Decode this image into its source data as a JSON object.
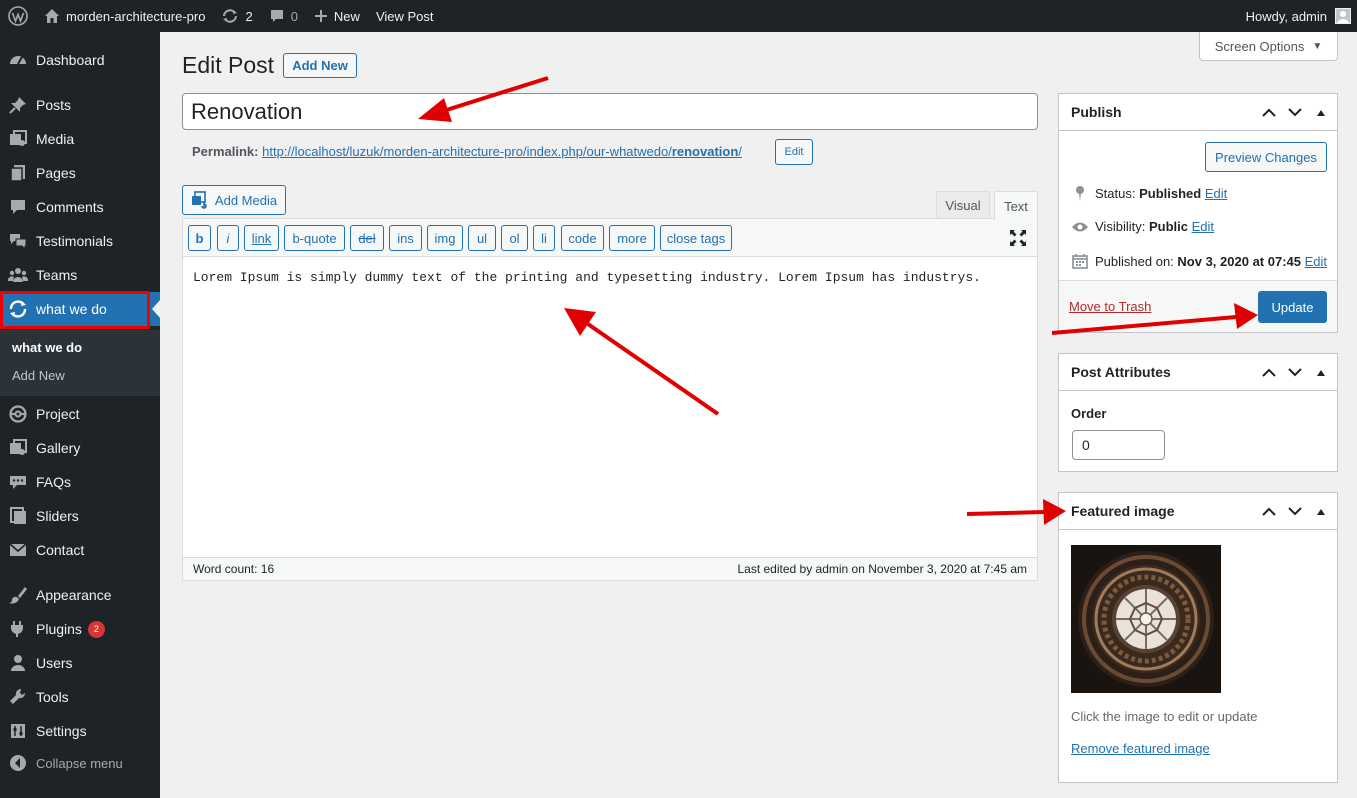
{
  "adminbar": {
    "site_name": "morden-architecture-pro",
    "updates_count": "2",
    "comments_count": "0",
    "new_label": "New",
    "view_post_label": "View Post",
    "howdy": "Howdy, admin"
  },
  "sidebar": {
    "items": [
      {
        "label": "Dashboard",
        "icon": "dashboard-icon"
      },
      {
        "label": "Posts",
        "icon": "pin-icon"
      },
      {
        "label": "Media",
        "icon": "media-icon"
      },
      {
        "label": "Pages",
        "icon": "page-icon"
      },
      {
        "label": "Comments",
        "icon": "comment-icon"
      },
      {
        "label": "Testimonials",
        "icon": "testimonial-icon"
      },
      {
        "label": "Teams",
        "icon": "groups-icon"
      },
      {
        "label": "what we do",
        "icon": "update-icon"
      },
      {
        "label": "Project",
        "icon": "project-icon"
      },
      {
        "label": "Gallery",
        "icon": "gallery-icon"
      },
      {
        "label": "FAQs",
        "icon": "faq-icon"
      },
      {
        "label": "Sliders",
        "icon": "slider-icon"
      },
      {
        "label": "Contact",
        "icon": "email-icon"
      },
      {
        "label": "Appearance",
        "icon": "brush-icon"
      },
      {
        "label": "Plugins",
        "icon": "plugin-icon"
      },
      {
        "label": "Users",
        "icon": "user-icon"
      },
      {
        "label": "Tools",
        "icon": "wrench-icon"
      },
      {
        "label": "Settings",
        "icon": "settings-icon"
      }
    ],
    "plugins_badge": "2",
    "submenu": [
      "what we do",
      "Add New"
    ],
    "collapse_label": "Collapse menu"
  },
  "header": {
    "screen_options": "Screen Options",
    "title": "Edit Post",
    "add_new": "Add New"
  },
  "post": {
    "title": "Renovation",
    "permalink_label": "Permalink:",
    "permalink_base": "http://localhost/luzuk/morden-architecture-pro/index.php/our-whatwedo/",
    "permalink_slug": "renovation",
    "permalink_trail": "/",
    "permalink_edit": "Edit"
  },
  "editor": {
    "add_media": "Add Media",
    "tab_visual": "Visual",
    "tab_text": "Text",
    "quicktags": [
      "b",
      "i",
      "link",
      "b-quote",
      "del",
      "ins",
      "img",
      "ul",
      "ol",
      "li",
      "code",
      "more",
      "close tags"
    ],
    "content": "Lorem Ipsum is simply dummy text of the printing and typesetting industry. Lorem Ipsum has industrys.",
    "word_count": "Word count: 16",
    "last_edited": "Last edited by admin on November 3, 2020 at 7:45 am"
  },
  "publish": {
    "title": "Publish",
    "preview": "Preview Changes",
    "status_label": "Status:",
    "status_value": "Published",
    "visibility_label": "Visibility:",
    "visibility_value": "Public",
    "published_label": "Published on:",
    "published_value": "Nov 3, 2020 at 07:45",
    "edit": "Edit",
    "trash": "Move to Trash",
    "update": "Update"
  },
  "attributes": {
    "title": "Post Attributes",
    "order_label": "Order",
    "order_value": "0"
  },
  "featured": {
    "title": "Featured image",
    "hint": "Click the image to edit or update",
    "remove": "Remove featured image"
  },
  "colors": {
    "admin_bg": "#1d2327",
    "accent": "#2271b1",
    "annotation": "#e00000"
  }
}
